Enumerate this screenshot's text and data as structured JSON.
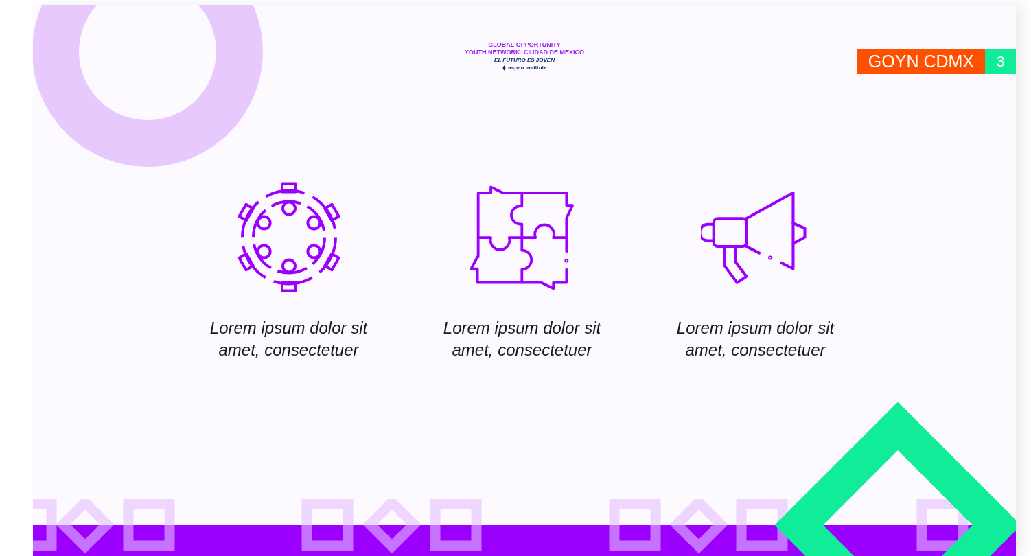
{
  "logo": {
    "lines": [
      {
        "kind": "title",
        "text": "GLOBAL OPPORTUNITY"
      },
      {
        "kind": "title",
        "text": "YOUTH NETWORK: CIUDAD DE MÉXICO"
      },
      {
        "kind": "tagline",
        "text": "EL FUTURO ES JOVEN"
      },
      {
        "kind": "sponsor",
        "text": "aspen institute"
      }
    ]
  },
  "badge": {
    "label": "GOYN CDMX",
    "page": "3"
  },
  "features": [
    {
      "kind": "gear",
      "text": "Lorem ipsum dolor sit amet, consectetuer"
    },
    {
      "kind": "puzzle",
      "text": "Lorem ipsum dolor sit amet, consectetuer"
    },
    {
      "kind": "megaphone",
      "text": "Lorem ipsum dolor sit amet, consectetuer"
    }
  ]
}
